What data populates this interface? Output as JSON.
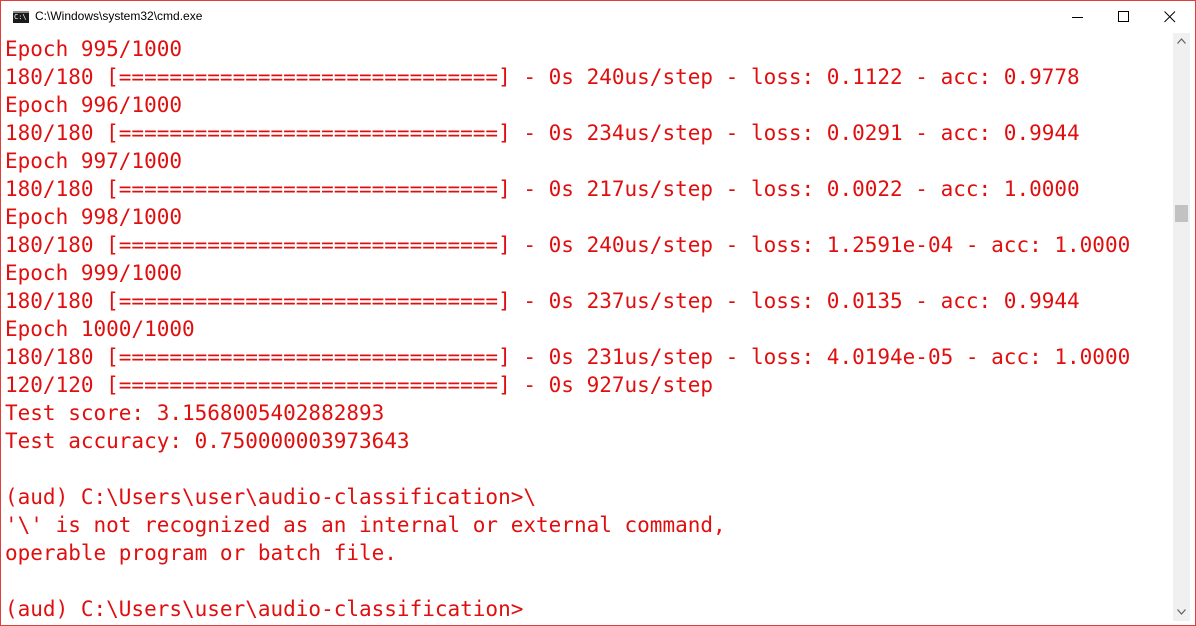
{
  "window": {
    "title": "C:\\Windows\\system32\\cmd.exe",
    "accent_color": "#e0403a"
  },
  "icons": {
    "app": "cmd-app-icon",
    "minimize": "minimize-icon",
    "maximize": "maximize-icon",
    "close": "close-icon",
    "scroll_up": "scroll-up-arrow-icon",
    "scroll_down": "scroll-down-arrow-icon"
  },
  "console": {
    "text_color": "#e00f0f",
    "lines": [
      "Epoch 995/1000",
      "180/180 [==============================] - 0s 240us/step - loss: 0.1122 - acc: 0.9778",
      "Epoch 996/1000",
      "180/180 [==============================] - 0s 234us/step - loss: 0.0291 - acc: 0.9944",
      "Epoch 997/1000",
      "180/180 [==============================] - 0s 217us/step - loss: 0.0022 - acc: 1.0000",
      "Epoch 998/1000",
      "180/180 [==============================] - 0s 240us/step - loss: 1.2591e-04 - acc: 1.0000",
      "Epoch 999/1000",
      "180/180 [==============================] - 0s 237us/step - loss: 0.0135 - acc: 0.9944",
      "Epoch 1000/1000",
      "180/180 [==============================] - 0s 231us/step - loss: 4.0194e-05 - acc: 1.0000",
      "120/120 [==============================] - 0s 927us/step",
      "Test score: 3.1568005402882893",
      "Test accuracy: 0.750000003973643",
      "",
      "(aud) C:\\Users\\user\\audio-classification>\\",
      "'\\' is not recognized as an internal or external command,",
      "operable program or batch file.",
      "",
      "(aud) C:\\Users\\user\\audio-classification>"
    ]
  }
}
